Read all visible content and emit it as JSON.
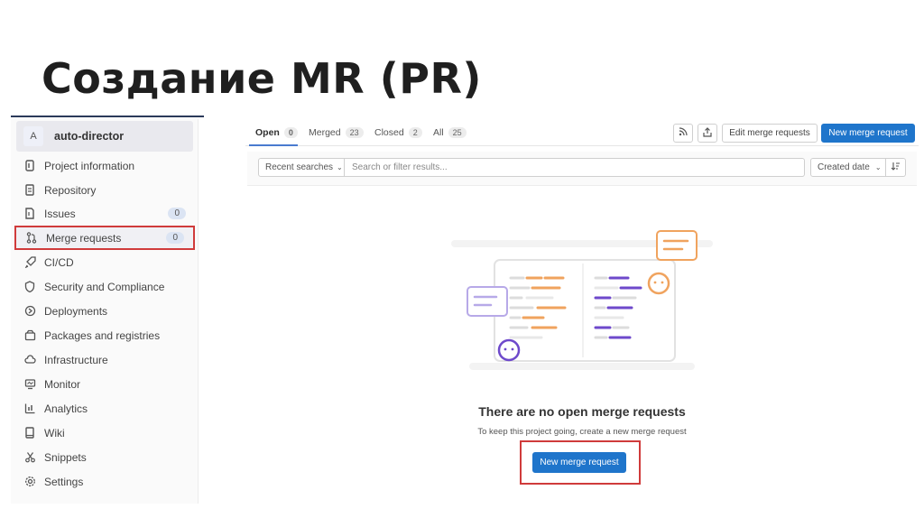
{
  "slide": {
    "title": "Создание MR (PR)"
  },
  "sidebar": {
    "project_avatar": "A",
    "project_name": "auto-director",
    "items": [
      {
        "label": "Project information",
        "icon": "info-doc-icon"
      },
      {
        "label": "Repository",
        "icon": "document-icon"
      },
      {
        "label": "Issues",
        "icon": "issues-icon",
        "count": "0"
      },
      {
        "label": "Merge requests",
        "icon": "merge-request-icon",
        "count": "0",
        "active": true
      },
      {
        "label": "CI/CD",
        "icon": "rocket-icon"
      },
      {
        "label": "Security and Compliance",
        "icon": "shield-icon"
      },
      {
        "label": "Deployments",
        "icon": "deployments-icon"
      },
      {
        "label": "Packages and registries",
        "icon": "package-icon"
      },
      {
        "label": "Infrastructure",
        "icon": "cloud-icon"
      },
      {
        "label": "Monitor",
        "icon": "monitor-icon"
      },
      {
        "label": "Analytics",
        "icon": "chart-icon"
      },
      {
        "label": "Wiki",
        "icon": "book-icon"
      },
      {
        "label": "Snippets",
        "icon": "scissors-icon"
      },
      {
        "label": "Settings",
        "icon": "gear-icon"
      }
    ]
  },
  "tabs": [
    {
      "label": "Open",
      "count": "0",
      "active": true
    },
    {
      "label": "Merged",
      "count": "23"
    },
    {
      "label": "Closed",
      "count": "2"
    },
    {
      "label": "All",
      "count": "25"
    }
  ],
  "toolbar": {
    "rss_icon": "rss-icon",
    "export_icon": "export-icon",
    "edit_label": "Edit merge requests",
    "new_label": "New merge request"
  },
  "filter": {
    "recent_label": "Recent searches",
    "placeholder": "Search or filter results...",
    "sort_label": "Created date",
    "sort_direction_icon": "sort-descending-icon"
  },
  "empty_state": {
    "title": "There are no open merge requests",
    "description": "To keep this project going, create a new merge request",
    "button_label": "New merge request"
  },
  "colors": {
    "primary": "#1f75cb",
    "highlight": "#d03b3b",
    "illustration_orange": "#f0a35e",
    "illustration_purple": "#6e49cb"
  }
}
